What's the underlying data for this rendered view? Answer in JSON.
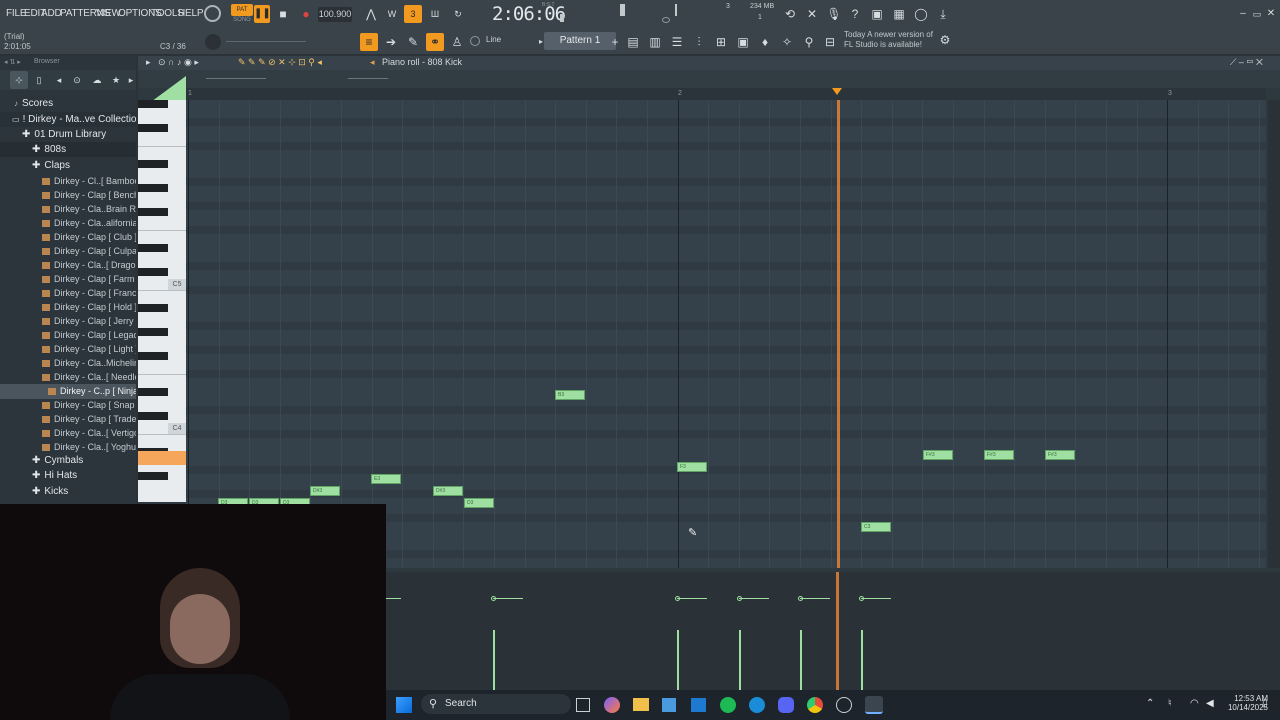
{
  "menu": {
    "items": [
      "FILE",
      "EDIT",
      "ADD",
      "PATTERNS",
      "VIEW",
      "OPTIONS",
      "TOOLS",
      "HELP"
    ]
  },
  "hint": {
    "mode": "(Trial)",
    "time": "2:01:05",
    "position": "C3 / 36"
  },
  "transport": {
    "pat_label": "PAT",
    "song_label": "SONG",
    "tempo": "100.900",
    "time": "2:06:06",
    "time_unit": "B:S:T",
    "pattern": "Pattern 1",
    "snap": "Line",
    "cpu_num": "3",
    "memory": "234 MB",
    "voices": "1"
  },
  "news": {
    "line1": "Today  A newer version of",
    "line2": "FL Studio is available!"
  },
  "browser": {
    "title": "Browser",
    "scores": "Scores",
    "collection": "! Dirkey - Ma..ve Collection",
    "drum_library": "01 Drum Library",
    "folders": [
      "808s",
      "Claps"
    ],
    "files": [
      "Dirkey - Cl..[ Bamboo ]",
      "Dirkey - Clap [ Bench ]",
      "Dirkey - Cla..Brain Rot ]",
      "Dirkey - Cla..alifornia ]",
      "Dirkey - Clap [ Club ]",
      "Dirkey - Clap [ Culpa ]",
      "Dirkey - Cla..[ Dragon ]",
      "Dirkey - Clap [ Farm ]",
      "Dirkey - Clap [ France ]",
      "Dirkey - Clap [ Hold ]",
      "Dirkey - Clap [ Jerry ]",
      "Dirkey - Clap [ Legacy ]",
      "Dirkey - Clap [ Light ]",
      "Dirkey - Cla..Michelin ]",
      "Dirkey - Cla..[ Needle ]",
      "Dirkey - C..p [ Ninja ]",
      "Dirkey - Clap [ Snap ]",
      "Dirkey - Clap [ Trade ]",
      "Dirkey - Cla..[ Vertigo ]",
      "Dirkey - Cla..[ Yoghurt ]"
    ],
    "more_folders": [
      "Cymbals",
      "Hi Hats",
      "Kicks"
    ]
  },
  "piano_roll": {
    "title": "Piano roll - 808 Kick",
    "ruler": [
      "1",
      "2",
      "3"
    ],
    "key_labels": [
      "C5",
      "C4"
    ],
    "notes": [
      {
        "label": "D3"
      },
      {
        "label": "D3"
      },
      {
        "label": "D3"
      },
      {
        "label": "D#3"
      },
      {
        "label": "E3"
      },
      {
        "label": "D#3"
      },
      {
        "label": "D3"
      },
      {
        "label": "B3"
      },
      {
        "label": "F3"
      },
      {
        "label": "C3"
      },
      {
        "label": "F#3"
      },
      {
        "label": "F#3"
      },
      {
        "label": "F#3"
      }
    ]
  },
  "taskbar": {
    "search": "Search",
    "time": "12:53 AM",
    "date": "10/14/2025"
  }
}
